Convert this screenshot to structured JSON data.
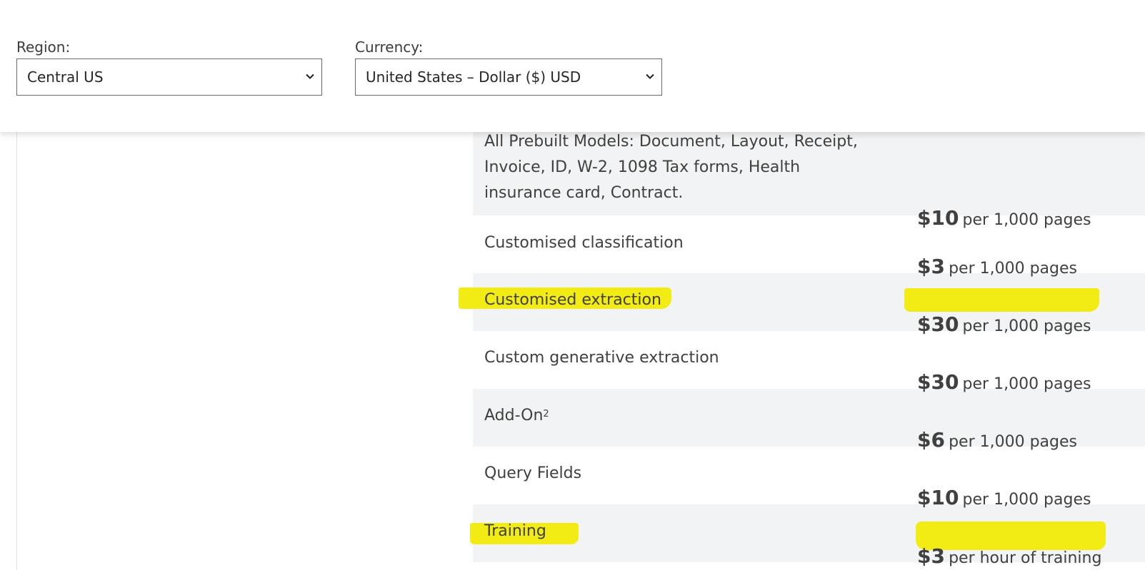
{
  "filters": {
    "region_label": "Region:",
    "region_value": "Central US",
    "currency_label": "Currency:",
    "currency_value": "United States – Dollar ($) USD"
  },
  "rows": [
    {
      "name": "All Prebuilt Models: Document, Layout, Receipt, Invoice, ID, W-2, 1098 Tax forms, Health insurance card, Contract.",
      "amount": "$10",
      "unit": "per 1,000 pages"
    },
    {
      "name": "Customised classification",
      "amount": "$3",
      "unit": "per 1,000 pages"
    },
    {
      "name": "Customised extraction",
      "amount": "$30",
      "unit": "per 1,000 pages",
      "highlighted": true
    },
    {
      "name": "Custom generative extraction",
      "amount": "$30",
      "unit": "per 1,000 pages"
    },
    {
      "name": "Add-On",
      "superscript": "2",
      "amount": "$6",
      "unit": "per 1,000 pages"
    },
    {
      "name": "Query Fields",
      "amount": "$10",
      "unit": "per 1,000 pages"
    },
    {
      "name": "Training",
      "amount": "$3",
      "unit": "per hour of training",
      "highlighted": true
    }
  ],
  "colors": {
    "highlight": "#f2ea00",
    "row_shade": "#f2f3f4"
  },
  "icons": {
    "dropdown": "chevron-down-icon"
  }
}
